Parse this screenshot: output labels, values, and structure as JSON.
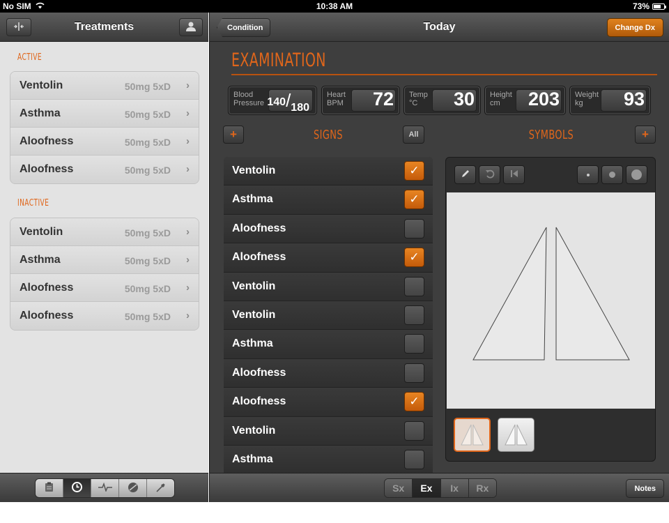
{
  "status_bar": {
    "carrier": "No SIM",
    "time": "10:38 AM",
    "battery": "73%",
    "battery_level": 0.73
  },
  "left": {
    "title": "Treatments",
    "active_label": "ACTIVE",
    "inactive_label": "INACTIVE",
    "active_items": [
      {
        "name": "Ventolin",
        "dose": "50mg 5xD"
      },
      {
        "name": "Asthma",
        "dose": "50mg 5xD"
      },
      {
        "name": "Aloofness",
        "dose": "50mg 5xD"
      },
      {
        "name": "Aloofness",
        "dose": "50mg 5xD"
      }
    ],
    "inactive_items": [
      {
        "name": "Ventolin",
        "dose": "50mg 5xD"
      },
      {
        "name": "Asthma",
        "dose": "50mg 5xD"
      },
      {
        "name": "Aloofness",
        "dose": "50mg 5xD"
      },
      {
        "name": "Aloofness",
        "dose": "50mg 5xD"
      }
    ],
    "toolbar_icons": [
      "clipboard-icon",
      "clock-icon",
      "pulse-icon",
      "pill-icon",
      "dropper-icon"
    ],
    "toolbar_selected": 1
  },
  "right": {
    "back_label": "Condition",
    "title": "Today",
    "change_dx_label": "Change Dx",
    "exam_title": "EXAMINATION",
    "vitals": {
      "bp": {
        "label_line1": "Blood",
        "label_line2": "Pressure",
        "systolic": "140",
        "diastolic": "180"
      },
      "heart": {
        "label_line1": "Heart",
        "label_line2": "BPM",
        "value": "72"
      },
      "temp": {
        "label_line1": "Temp",
        "label_line2": "°C",
        "value": "30"
      },
      "height": {
        "label_line1": "Height",
        "label_line2": "cm",
        "value": "203"
      },
      "weight": {
        "label_line1": "Weight",
        "label_line2": "kg",
        "value": "93"
      }
    },
    "signs_title": "SIGNS",
    "all_label": "All",
    "symbols_title": "SYMBOLS",
    "add_label": "+",
    "signs": [
      {
        "name": "Ventolin",
        "checked": true
      },
      {
        "name": "Asthma",
        "checked": true
      },
      {
        "name": "Aloofness",
        "checked": false
      },
      {
        "name": "Aloofness",
        "checked": true
      },
      {
        "name": "Ventolin",
        "checked": false
      },
      {
        "name": "Ventolin",
        "checked": false
      },
      {
        "name": "Asthma",
        "checked": false
      },
      {
        "name": "Aloofness",
        "checked": false
      },
      {
        "name": "Aloofness",
        "checked": true
      },
      {
        "name": "Ventolin",
        "checked": false
      },
      {
        "name": "Asthma",
        "checked": false
      }
    ],
    "check_glyph": "✓",
    "segments": [
      "Sx",
      "Ex",
      "Ix",
      "Rx"
    ],
    "segment_selected": 1,
    "notes_label": "Notes"
  },
  "colors": {
    "accent": "#e0661b",
    "dark_bg": "#3e3e3e",
    "light_bg": "#e3e3e3"
  }
}
